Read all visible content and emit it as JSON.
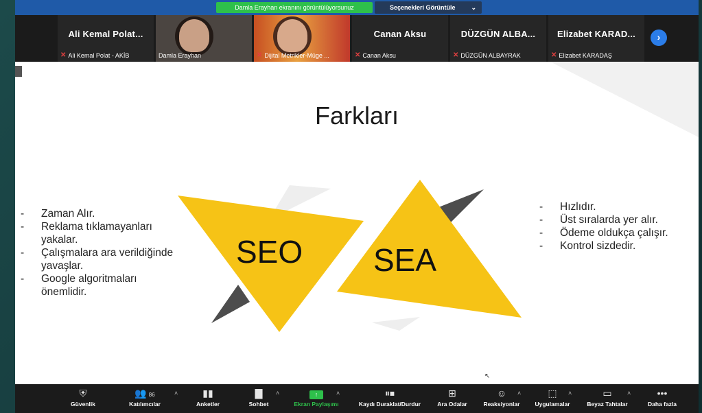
{
  "topbar": {
    "sharing_text": "Damla Erayhan ekranını görüntülüyorsunuz",
    "options_label": "Seçenekleri Görüntüle",
    "options_caret": "⌄"
  },
  "participants": [
    {
      "display": "Ali Kemal Polat...",
      "name": "Ali Kemal Polat - AKİB"
    },
    {
      "display": "",
      "name": "Damla Erayhan"
    },
    {
      "display": "",
      "name": "Dijital Metrikler-Müge ..."
    },
    {
      "display": "Canan Aksu",
      "name": "Canan Aksu"
    },
    {
      "display": "DÜZGÜN ALBA...",
      "name": "DÜZGÜN ALBAYRAK"
    },
    {
      "display": "Elizabet KARAD...",
      "name": "Elizabet KARADAŞ"
    }
  ],
  "slide": {
    "title": "Farkları",
    "seo_label": "SEO",
    "sea_label": "SEA",
    "left_items": [
      "Zaman Alır.",
      "Reklama tıklamayanları yakalar.",
      "Çalışmalara ara verildiğinde yavaşlar.",
      "Google algoritmaları önemlidir."
    ],
    "right_items": [
      "Hızlıdır.",
      "Üst sıralarda yer alır.",
      "Ödeme oldukça çalışır.",
      "Kontrol sizdedir."
    ],
    "bullet": "-"
  },
  "toolbar": {
    "items": [
      {
        "label": "Güvenlik",
        "icon": "shield-icon"
      },
      {
        "label": "Katılımcılar",
        "icon": "participants-icon",
        "count": "86"
      },
      {
        "label": "Anketler",
        "icon": "polls-icon"
      },
      {
        "label": "Sohbet",
        "icon": "chat-icon"
      },
      {
        "label": "Ekran Paylaşımı",
        "icon": "share-screen-icon"
      },
      {
        "label": "Kaydı Duraklat/Durdur",
        "icon": "pause-stop-record-icon"
      },
      {
        "label": "Ara Odalar",
        "icon": "breakout-rooms-icon"
      },
      {
        "label": "Reaksiyonlar",
        "icon": "reactions-icon"
      },
      {
        "label": "Uygulamalar",
        "icon": "apps-icon"
      },
      {
        "label": "Beyaz Tahtalar",
        "icon": "whiteboard-icon"
      },
      {
        "label": "Daha fazla",
        "icon": "more-icon"
      }
    ]
  },
  "colors": {
    "accent_green": "#2ec04b",
    "accent_blue": "#2b7de9",
    "triangle_yellow": "#f6c316",
    "triangle_gray": "#4d4d4d"
  }
}
